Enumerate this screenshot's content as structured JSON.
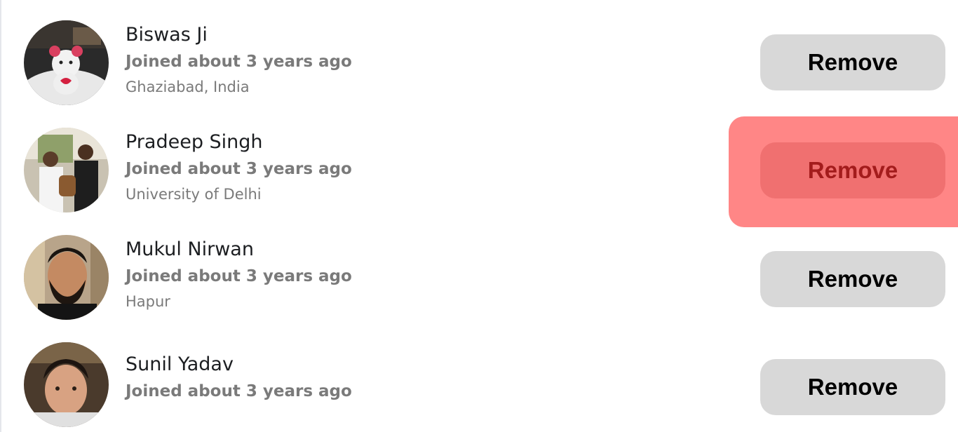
{
  "members": [
    {
      "name": "Biswas Ji",
      "joined": "Joined about 3 years ago",
      "location": "Ghaziabad, India",
      "action_label": "Remove"
    },
    {
      "name": "Pradeep Singh",
      "joined": "Joined about 3 years ago",
      "location": "University of Delhi",
      "action_label": "Remove",
      "highlighted": true
    },
    {
      "name": "Mukul Nirwan",
      "joined": "Joined about 3 years ago",
      "location": "Hapur",
      "action_label": "Remove"
    },
    {
      "name": "Sunil Yadav",
      "joined": "Joined about 3 years ago",
      "action_label": "Remove"
    }
  ],
  "colors": {
    "button_bg": "#d8d8d8",
    "highlight_bg": "#ff8686",
    "highlight_button_bg": "#f07070",
    "highlight_button_text": "#a31c1c",
    "secondary_text": "#7a7a7a"
  }
}
